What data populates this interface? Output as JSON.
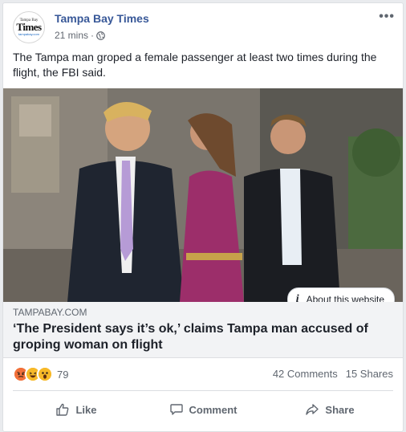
{
  "post": {
    "page_name": "Tampa Bay Times",
    "time": "21 mins",
    "time_separator": "·",
    "privacy_icon": "globe-icon",
    "more_icon": "ellipsis-icon",
    "text": "The Tampa man groped a female passenger at least two times during the flight, the FBI said."
  },
  "avatar": {
    "top": "Tampa Bay",
    "main": "Times",
    "sub": "tampabay.com"
  },
  "link": {
    "about_label": "About this website",
    "domain": "TAMPABAY.COM",
    "headline": "‘The President says it’s ok,’ claims Tampa man accused of groping woman on flight"
  },
  "stats": {
    "reaction_icons": [
      "angry-reaction-icon",
      "haha-reaction-icon",
      "wow-reaction-icon"
    ],
    "reaction_count": "79",
    "comments": "42 Comments",
    "shares": "15 Shares"
  },
  "actions": {
    "like": "Like",
    "comment": "Comment",
    "share": "Share"
  },
  "colors": {
    "link_blue": "#385898",
    "meta_gray": "#616770",
    "link_box_bg": "#f2f3f5"
  }
}
